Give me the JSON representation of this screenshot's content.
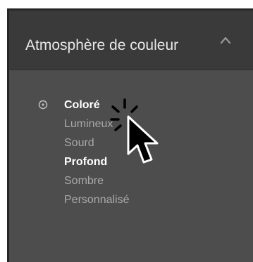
{
  "panel": {
    "title": "Atmosphère de couleur",
    "collapse_icon": "chevron-up-icon"
  },
  "options": [
    {
      "label": "Coloré",
      "selected": true,
      "emphasis": "bold"
    },
    {
      "label": "Lumineux",
      "selected": false,
      "emphasis": "normal"
    },
    {
      "label": "Sourd",
      "selected": false,
      "emphasis": "normal"
    },
    {
      "label": "Profond",
      "selected": false,
      "emphasis": "bold"
    },
    {
      "label": "Sombre",
      "selected": false,
      "emphasis": "normal"
    },
    {
      "label": "Personnalisé",
      "selected": false,
      "emphasis": "normal"
    }
  ],
  "colors": {
    "panel_background": "#4d4d4d",
    "header_background": "#3a3a3a",
    "text_primary": "#ffffff",
    "text_muted": "#a9a9a9"
  },
  "cursor": "arrow-cursor-click-icon"
}
